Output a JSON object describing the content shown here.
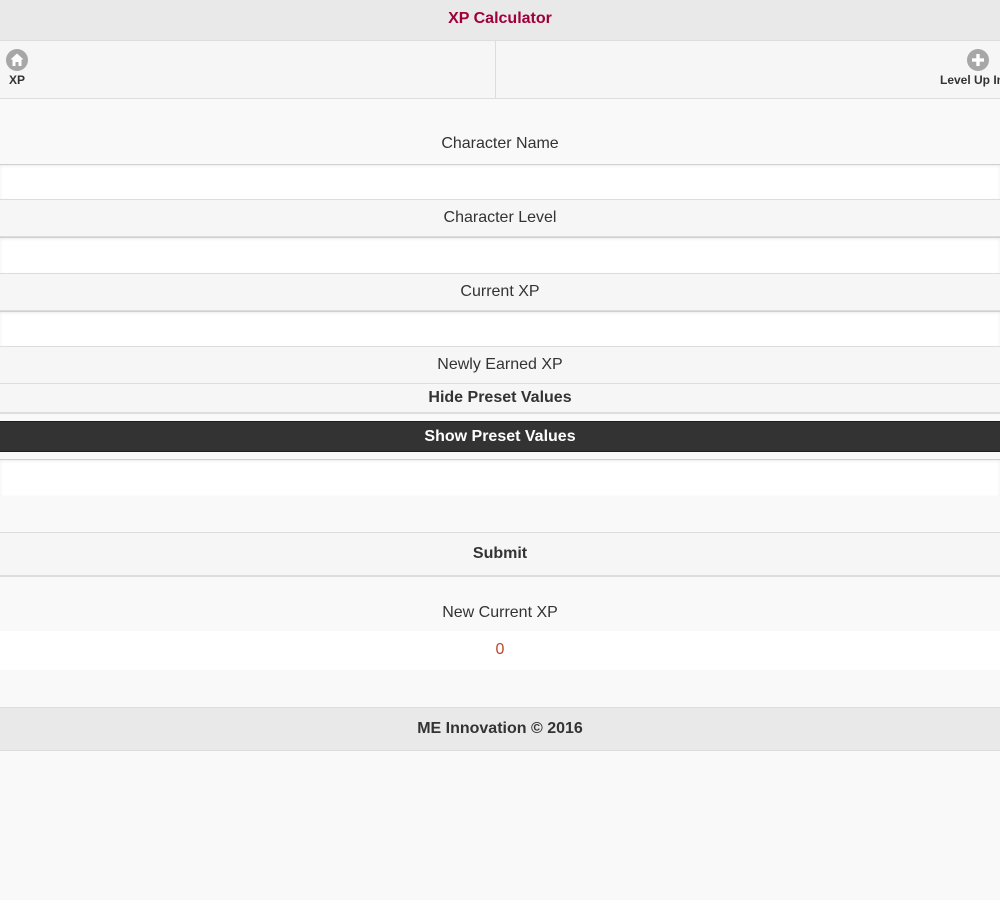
{
  "header": {
    "title": "XP Calculator"
  },
  "nav": {
    "items": [
      {
        "label": "XP",
        "icon": "home-icon"
      },
      {
        "label": "Level Up Info",
        "icon": "plus-icon"
      }
    ]
  },
  "form": {
    "character_name_label": "Character Name",
    "character_name_value": "",
    "character_level_label": "Character Level",
    "character_level_value": "",
    "current_xp_label": "Current XP",
    "current_xp_value": "",
    "newly_earned_xp_label": "Newly Earned XP",
    "hide_preset_label": "Hide Preset Values",
    "show_preset_label": "Show Preset Values",
    "newly_earned_xp_value": "",
    "submit_label": "Submit"
  },
  "result": {
    "label": "New Current XP",
    "value": "0"
  },
  "footer": {
    "text": "ME Innovation © 2016"
  },
  "colors": {
    "title": "#a0003a",
    "result_value": "#c0442a",
    "active_button_bg": "#333333"
  }
}
